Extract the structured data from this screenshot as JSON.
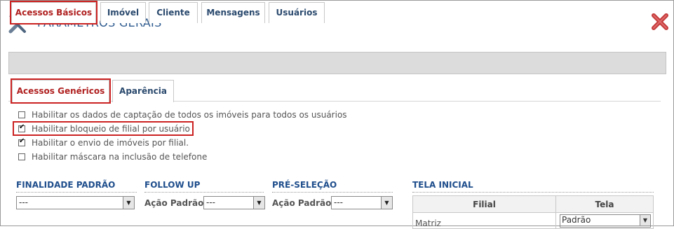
{
  "header": {
    "title": "PARÂMETROS GERAIS",
    "icon": "tools-icon",
    "close_icon": "close-icon"
  },
  "tabs": [
    {
      "label": "Acessos Básicos",
      "active": true
    },
    {
      "label": "Imóvel",
      "active": false
    },
    {
      "label": "Cliente",
      "active": false
    },
    {
      "label": "Mensagens",
      "active": false
    },
    {
      "label": "Usuários",
      "active": false
    }
  ],
  "subtabs": [
    {
      "label": "Acessos Genéricos",
      "active": true
    },
    {
      "label": "Aparência",
      "active": false
    }
  ],
  "options": [
    {
      "label": "Habilitar os dados de captação de todos os imóveis para todos os usuários",
      "checked": false
    },
    {
      "label": "Habilitar bloqueio de filial por usuário",
      "checked": true
    },
    {
      "label": "Habilitar o envio de imóveis por filial.",
      "checked": true
    },
    {
      "label": "Habilitar máscara na inclusão de telefone",
      "checked": false
    }
  ],
  "sections": {
    "finalidade": {
      "title": "FINALIDADE PADRÃO",
      "value": "---"
    },
    "followup": {
      "title": "FOLLOW UP",
      "action_label": "Ação Padrão:",
      "value": "---"
    },
    "preselecao": {
      "title": "PRÉ-SELEÇÃO",
      "action_label": "Ação Padrão:",
      "value": "---"
    },
    "tela_inicial": {
      "title": "TELA INICIAL",
      "columns": [
        "Filial",
        "Tela"
      ],
      "rows": [
        {
          "filial": "Matriz",
          "tela": "Padrão"
        }
      ]
    }
  },
  "colors": {
    "accent": "#cc2222",
    "title": "#2d5a8e",
    "section": "#1f4e8c"
  }
}
